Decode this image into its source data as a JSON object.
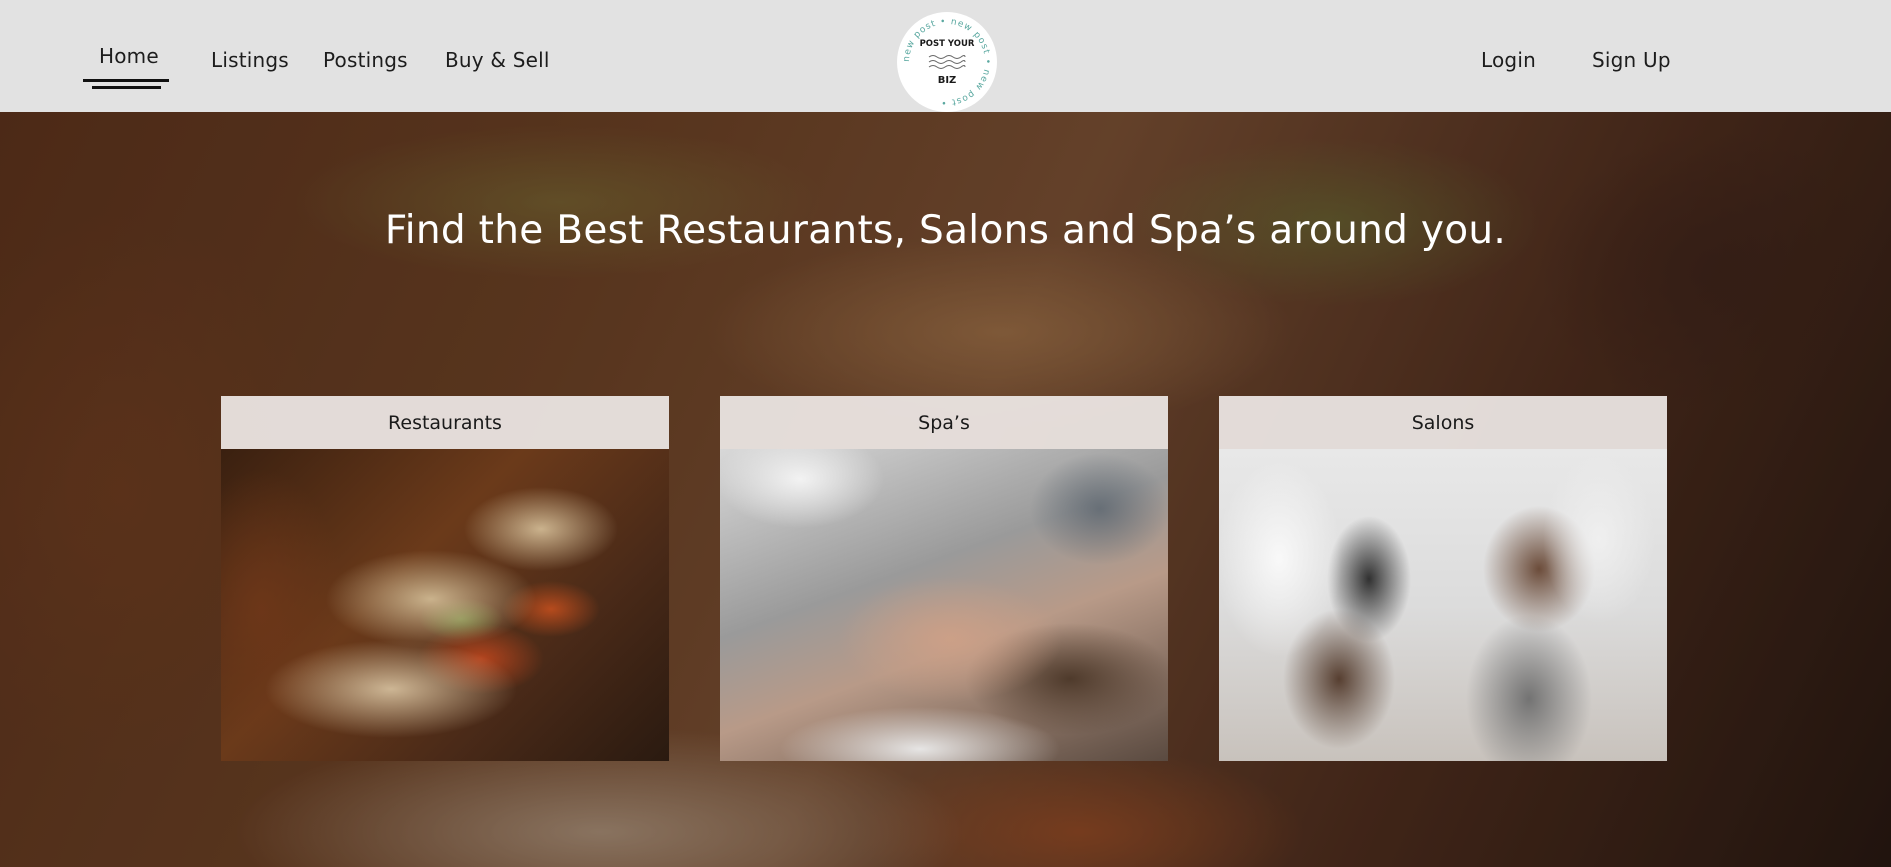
{
  "header": {
    "nav_left": [
      {
        "label": "Home"
      },
      {
        "label": "Listings"
      },
      {
        "label": "Postings"
      },
      {
        "label": "Buy & Sell"
      }
    ],
    "logo": {
      "top_text": "POST YOUR",
      "bottom_text": "BIZ",
      "ring_text": "new post • new post • new post •"
    },
    "nav_right": [
      {
        "label": "Login"
      },
      {
        "label": "Sign Up"
      }
    ]
  },
  "hero": {
    "title": "Find the Best Restaurants, Salons and Spa’s around you."
  },
  "cards": [
    {
      "label": "Restaurants"
    },
    {
      "label": "Spa’s"
    },
    {
      "label": "Salons"
    }
  ],
  "colors": {
    "header_bg": "#e2e2e2",
    "text_dark": "#1d1d1d",
    "hero_text": "#ffffff",
    "card_header_bg": "#eee8e6"
  }
}
